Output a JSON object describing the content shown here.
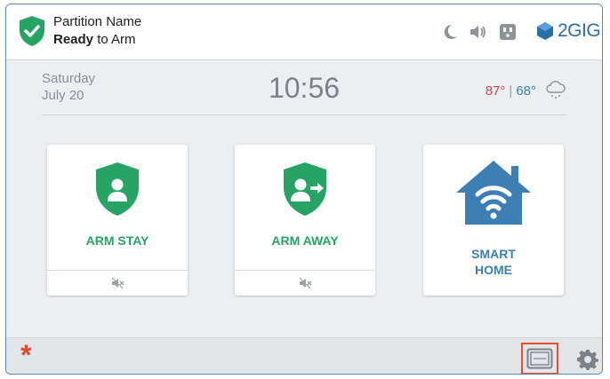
{
  "header": {
    "partition_name": "Partition Name",
    "status_bold": "Ready",
    "status_rest": " to Arm",
    "brand": "2GIG",
    "icons": [
      "moon-icon",
      "speaker-icon",
      "outlet-icon",
      "brand-logo-icon"
    ]
  },
  "info": {
    "day": "Saturday",
    "date": "July 20",
    "time": "10:56",
    "temp_high": "87°",
    "temp_sep": "|",
    "temp_low": "68°",
    "weather_icon": "snow-cloud-icon"
  },
  "tiles": [
    {
      "label": "ARM STAY",
      "icon": "shield-person-icon",
      "footer_icon": "mute-icon"
    },
    {
      "label": "ARM AWAY",
      "icon": "shield-person-arrow-icon",
      "footer_icon": "mute-icon"
    },
    {
      "label_line1": "SMART",
      "label_line2": "HOME",
      "icon": "home-wifi-icon"
    }
  ],
  "bottom": {
    "emergency": "*",
    "icons": [
      "emergency-icon",
      "panel-icon",
      "gear-icon"
    ]
  },
  "colors": {
    "green": "#27a463",
    "blue": "#3d7fb5",
    "highlight": "#e84f30",
    "emergency": "#e8442e"
  }
}
